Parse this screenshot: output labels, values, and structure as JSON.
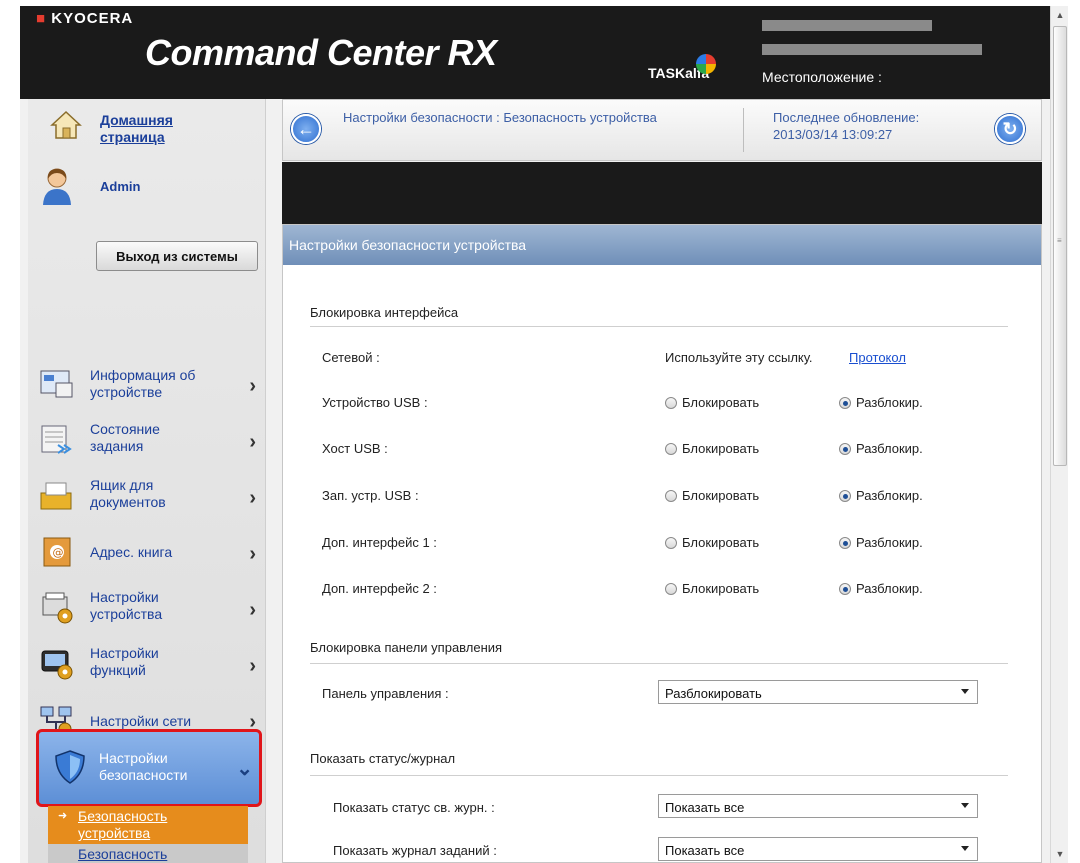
{
  "header": {
    "brand": "KYOCERA",
    "product": "Command Center RX",
    "model_family": "TASKalfa",
    "location_label": "Местоположение :"
  },
  "sidebar": {
    "home_label": "Домашняя страница",
    "user_name": "Admin",
    "logout_label": "Выход из системы",
    "items": [
      {
        "label": "Информация об устройстве",
        "icon": "device-info-icon"
      },
      {
        "label": "Состояние задания",
        "icon": "job-status-icon"
      },
      {
        "label": "Ящик для документов",
        "icon": "document-box-icon"
      },
      {
        "label": "Адрес. книга",
        "icon": "address-book-icon"
      },
      {
        "label": "Настройки устройства",
        "icon": "device-settings-icon"
      },
      {
        "label": "Настройки функций",
        "icon": "function-settings-icon"
      },
      {
        "label": "Настройки сети",
        "icon": "network-settings-icon"
      },
      {
        "label": "Настройки безопасности",
        "icon": "shield-icon"
      }
    ],
    "subitems": [
      {
        "label": "Безопасность устройства"
      },
      {
        "label": "Безопасность"
      }
    ]
  },
  "breadcrumb": {
    "path": "Настройки безопасности : Безопасность устройства",
    "update_label": "Последнее обновление:",
    "update_time": "2013/03/14 13:09:27"
  },
  "panel": {
    "title": "Настройки безопасности устройства",
    "interface_block": {
      "title": "Блокировка интерфейса",
      "network_label": "Сетевой :",
      "network_hint": "Используйте эту ссылку.",
      "network_link": "Протокол",
      "lock_option": "Блокировать",
      "unlock_option": "Разблокир.",
      "rows": [
        {
          "label": "Устройство USB :",
          "selected": "unlock"
        },
        {
          "label": "Хост USB :",
          "selected": "unlock"
        },
        {
          "label": "Зап. устр. USB :",
          "selected": "unlock"
        },
        {
          "label": "Доп. интерфейс 1 :",
          "selected": "unlock"
        },
        {
          "label": "Доп. интерфейс 2 :",
          "selected": "unlock"
        }
      ]
    },
    "panel_lock": {
      "title": "Блокировка панели управления",
      "label": "Панель управления :",
      "value": "Разблокировать"
    },
    "status_log": {
      "title": "Показать статус/журнал",
      "rows": [
        {
          "label": "Показать статус св. журн. :",
          "value": "Показать все"
        },
        {
          "label": "Показать журнал заданий :",
          "value": "Показать все"
        }
      ]
    }
  },
  "colors": {
    "header_bg": "#1a1a1a",
    "link_blue": "#1b3f9a",
    "highlight_red": "#e0151a",
    "submenu_orange": "#e68c1c",
    "panel_title_bg": "#6f8fb8"
  }
}
